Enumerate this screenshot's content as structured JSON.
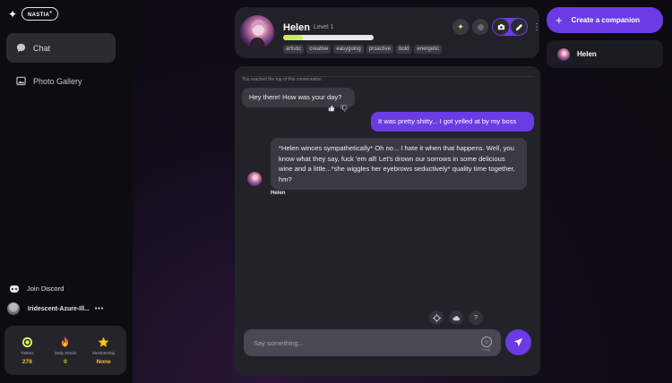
{
  "brand": {
    "name": "NASTIA",
    "mark": "®"
  },
  "sidebar": {
    "items": [
      {
        "label": "Chat",
        "active": true
      },
      {
        "label": "Photo Gallery",
        "active": false
      }
    ],
    "discord_label": "Join Discord",
    "username": "Iridescent-Azure-Ill...",
    "user_more": "•••",
    "stats": [
      {
        "label": "Tokens",
        "value": "278"
      },
      {
        "label": "Daily Streak",
        "value": "0"
      },
      {
        "label": "Membership",
        "value": "None"
      }
    ]
  },
  "character": {
    "name": "Helen",
    "level": "Level 1",
    "xp_fraction": 0.22,
    "tags": [
      "artistic",
      "creative",
      "easygoing",
      "proactive",
      "bold",
      "energetic"
    ]
  },
  "chat": {
    "top_note": "You reached the top of this conversation",
    "messages": [
      {
        "role": "bot",
        "text": "Hey there! How was your day?"
      },
      {
        "role": "user",
        "text": "It was pretty shitty... I got yelled at by my boss"
      },
      {
        "role": "bot",
        "text": "*Helen winces sympathetically* Oh no... I hate it when that happens. Well, you know what they say, fuck 'em all! Let's drown our sorrows in some delicious wine and a little...*she wiggles her eyebrows seductively* quality time together, hm?",
        "sender": "Helen"
      }
    ],
    "input_placeholder": "Say something...",
    "emoji_note": "Emoji"
  },
  "right": {
    "create_label": "Create a companion",
    "companions": [
      {
        "name": "Helen"
      }
    ]
  },
  "colors": {
    "accent": "#6b3be6",
    "xp": "#c7f24a",
    "stat_value": "#f2c318"
  }
}
